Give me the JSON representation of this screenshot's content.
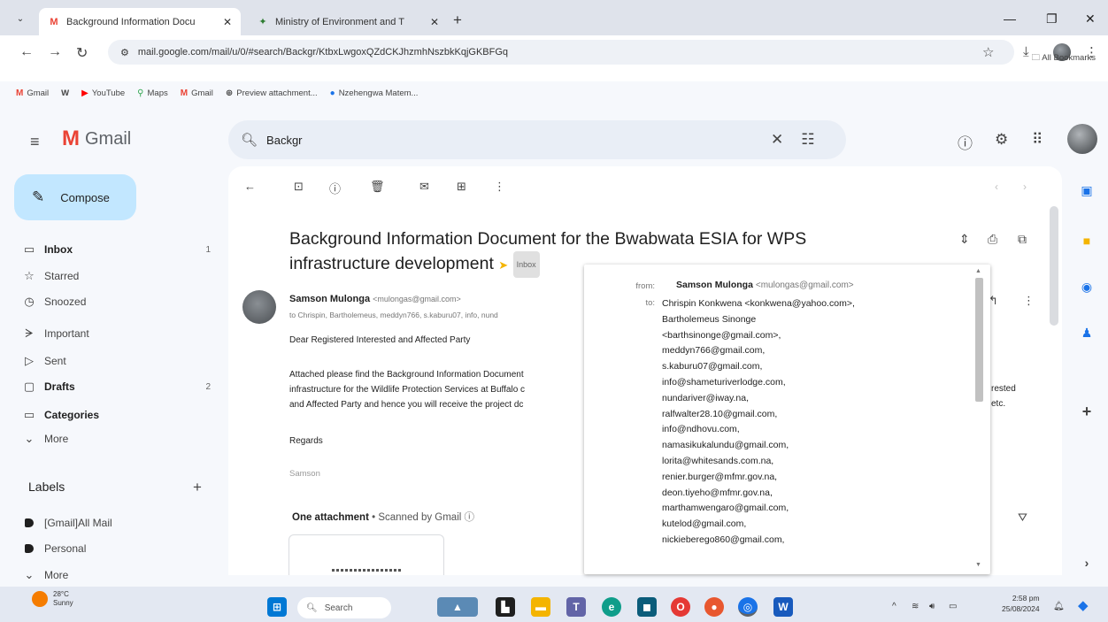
{
  "browser": {
    "tabs": [
      {
        "title": "Background Information Docu",
        "favicon": "M",
        "favicon_color": "#ea4335",
        "active": true
      },
      {
        "title": "Ministry of Environment and T",
        "favicon": "✦",
        "favicon_color": "#2e7d32",
        "active": false
      }
    ],
    "url": "mail.google.com/mail/u/0/#search/Backgr/KtbxLwgoxQZdCKJhzmhNszbkKqjGKBFGq",
    "bookmarks": [
      "Gmail",
      "W",
      "YouTube",
      "Maps",
      "Gmail",
      "Preview attachment...",
      "Nzehengwa Matem..."
    ],
    "all_bookmarks": "All Bookmarks"
  },
  "gmail": {
    "logo_text": "Gmail",
    "search_value": "Backgr",
    "compose_label": "Compose",
    "nav": [
      {
        "label": "Inbox",
        "count": "1",
        "bold": true,
        "icon": "▭"
      },
      {
        "label": "Starred",
        "count": "",
        "bold": false,
        "icon": "☆"
      },
      {
        "label": "Snoozed",
        "count": "",
        "bold": false,
        "icon": "◷"
      },
      {
        "label": "Important",
        "count": "",
        "bold": false,
        "icon": "ᗒ"
      },
      {
        "label": "Sent",
        "count": "",
        "bold": false,
        "icon": "▷"
      },
      {
        "label": "Drafts",
        "count": "2",
        "bold": true,
        "icon": "▢"
      },
      {
        "label": "Categories",
        "count": "",
        "bold": true,
        "icon": "▭"
      },
      {
        "label": "More",
        "count": "",
        "bold": false,
        "icon": "⌄"
      }
    ],
    "labels_header": "Labels",
    "labels": [
      "[Gmail]All Mail",
      "Personal",
      "More"
    ]
  },
  "email": {
    "subject_line1": "Background Information Document for the Bwabwata ESIA for WPS",
    "subject_line2": "infrastructure development",
    "inbox_chip": "Inbox",
    "sender_name": "Samson Mulonga",
    "sender_email": "<mulongas@gmail.com>",
    "to_line": "to Chrispin, Bartholemeus, meddyn766, s.kaburu07, info, nund",
    "greeting": "Dear Registered Interested and Affected Party",
    "para_line1": "Attached please find the Background Information Document",
    "para_line2": "infrastructure for the Wildlife Protection Services at Buffalo c",
    "para_line3": "and Affected Party and hence you will receive the project dc",
    "para_frag1": "rested",
    "para_frag2": "etc.",
    "regards": "Regards",
    "signature": "Samson",
    "attachment_count": "One attachment",
    "scanned": "• Scanned by Gmail ⓘ"
  },
  "details": {
    "from_label": "from:",
    "to_label": "to:",
    "from_name": "Samson Mulonga",
    "from_email": "<mulongas@gmail.com>",
    "recipients": [
      "Chrispin Konkwena <konkwena@yahoo.com>,",
      "Bartholemeus Sinonge",
      "<barthsinonge@gmail.com>,",
      "meddyn766@gmail.com,",
      "s.kaburu07@gmail.com,",
      "info@shameturiverlodge.com,",
      "nundariver@iway.na,",
      "ralfwalter28.10@gmail.com,",
      "info@ndhovu.com,",
      "namasikukalundu@gmail.com,",
      "lorita@whitesands.com.na,",
      "renier.burger@mfmr.gov.na,",
      "deon.tiyeho@mfmr.gov.na,",
      "marthamwengaro@gmail.com,",
      "kutelod@gmail.com,",
      "nickieberego860@gmail.com,"
    ]
  },
  "taskbar": {
    "temp": "28°C",
    "condition": "Sunny",
    "search_label": "Search",
    "time": "2:58 pm",
    "date": "25/08/2024"
  }
}
